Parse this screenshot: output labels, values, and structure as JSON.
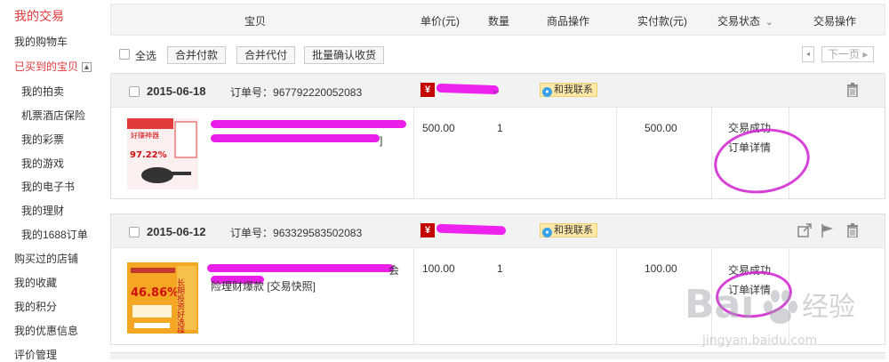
{
  "sidebar": {
    "items": [
      {
        "label": "我的交易"
      },
      {
        "label": "我的购物车"
      },
      {
        "label": "已买到的宝贝",
        "collapse": "▲"
      },
      {
        "label": "我的拍卖"
      },
      {
        "label": "机票酒店保险"
      },
      {
        "label": "我的彩票"
      },
      {
        "label": "我的游戏"
      },
      {
        "label": "我的电子书"
      },
      {
        "label": "我的理财"
      },
      {
        "label": "我的1688订单"
      },
      {
        "label": "购买过的店铺"
      },
      {
        "label": "我的收藏"
      },
      {
        "label": "我的积分"
      },
      {
        "label": "我的优惠信息"
      },
      {
        "label": "评价管理"
      }
    ]
  },
  "table_header": {
    "item": "宝贝",
    "unit_price": "单价(元)",
    "quantity": "数量",
    "item_ops": "商品操作",
    "paid": "实付款(元)",
    "status": "交易状态",
    "status_caret": "⌄",
    "ops": "交易操作"
  },
  "actions": {
    "select_all": "全选",
    "merge_pay": "合并付款",
    "merge_proxy_pay": "合并代付",
    "batch_confirm": "批量确认收货",
    "prev": "◂",
    "next_page": "下一页 ▸"
  },
  "orders": [
    {
      "date": "2015-06-18",
      "order_no_label": "订单号：",
      "order_no": "967792220052083",
      "shop_icon": "¥",
      "shop_dots": "..",
      "contact": "和我联系",
      "title_tail": "]",
      "unit_price": "500.00",
      "quantity": "1",
      "paid": "500.00",
      "status": "交易成功",
      "detail": "订单详情",
      "thumb_lines": [
        "好赚神器",
        "97.22%"
      ],
      "icons": [
        "trash-icon"
      ]
    },
    {
      "date": "2015-06-12",
      "order_no_label": "订单号：",
      "order_no": "963329583502083",
      "shop_icon": "¥",
      "contact": "和我联系",
      "title_tail": "会",
      "title_line2": "险理财爆款 [交易快照]",
      "unit_price": "100.00",
      "quantity": "1",
      "paid": "100.00",
      "status": "交易成功",
      "detail": "订单详情",
      "thumb_lines": [
        "46.86%",
        "长期投资好选择"
      ],
      "icons": [
        "share-icon",
        "flag-icon",
        "trash-icon"
      ]
    }
  ],
  "watermark": {
    "brand": "Bai",
    "brand2": "经验",
    "url": "jingyan.baidu.com"
  },
  "colors": {
    "accent": "#e4393c",
    "scribble": "#e91ee9"
  }
}
